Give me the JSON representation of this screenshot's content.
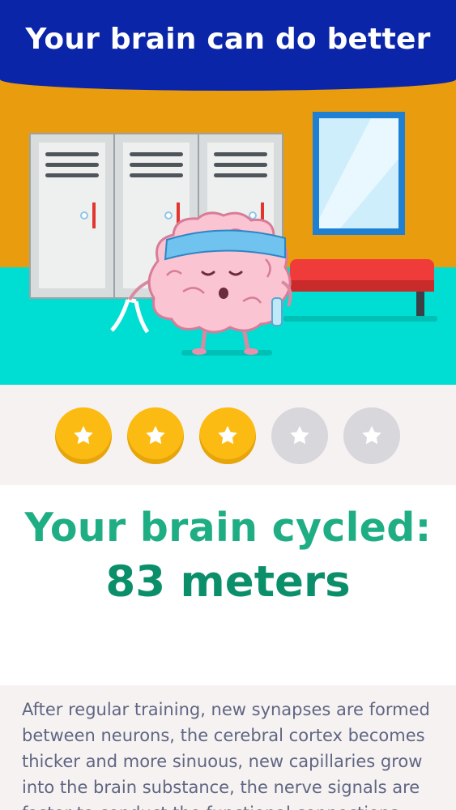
{
  "header": {
    "title": "Your brain can do better"
  },
  "colors": {
    "header": "#0b25a8",
    "wall": "#e89c0e",
    "floor": "#00ddd3",
    "star_on": "#fbbb13",
    "star_off": "#d7d7dc",
    "result_label": "#1fae84",
    "result_value": "#0b8f6a",
    "description_text": "#5e6682"
  },
  "rating": {
    "score": 3,
    "max": 5
  },
  "result": {
    "label": "Your brain cycled:",
    "value": "83 meters"
  },
  "description": {
    "text": "After regular training, new synapses are formed between neurons, the cerebral cortex becomes thicker and more sinuous, new capillaries grow into the brain substance, the nerve signals are faster to conduct the functional connections..."
  }
}
